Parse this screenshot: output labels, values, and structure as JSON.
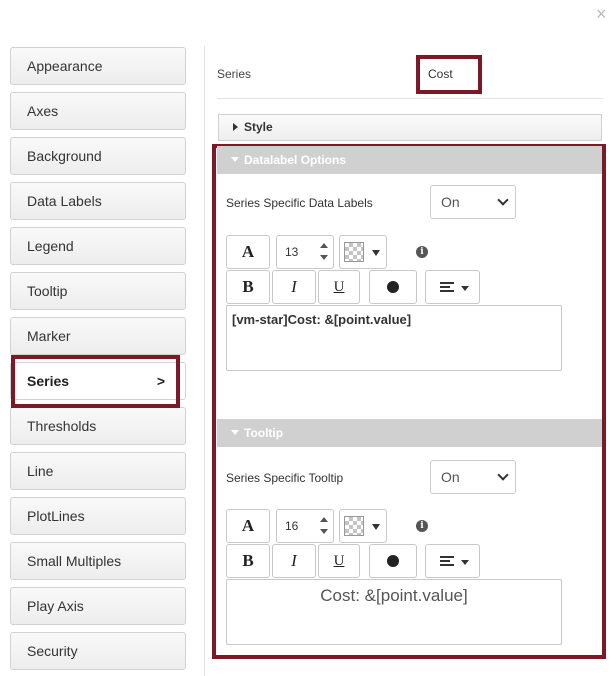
{
  "close_label": "×",
  "sidebar": {
    "items": [
      {
        "label": "Appearance"
      },
      {
        "label": "Axes"
      },
      {
        "label": "Background"
      },
      {
        "label": "Data Labels"
      },
      {
        "label": "Legend"
      },
      {
        "label": "Tooltip"
      },
      {
        "label": "Marker"
      },
      {
        "label": "Series",
        "active": true,
        "chevron": ">"
      },
      {
        "label": "Thresholds"
      },
      {
        "label": "Line"
      },
      {
        "label": "PlotLines"
      },
      {
        "label": "Small Multiples"
      },
      {
        "label": "Play Axis"
      },
      {
        "label": "Security"
      }
    ]
  },
  "main": {
    "series_label": "Series",
    "series_value": "Cost",
    "style_section": {
      "title": "Style"
    },
    "datalabel_section": {
      "title": "Datalabel Options",
      "field_label": "Series Specific Data Labels",
      "toggle_value": "On",
      "font_glyph": "A",
      "font_size": "13",
      "bold": "B",
      "italic": "I",
      "underline": "U",
      "text": "[vm-star]Cost: &[point.value]"
    },
    "tooltip_section": {
      "title": "Tooltip",
      "field_label": "Series Specific Tooltip",
      "toggle_value": "On",
      "font_glyph": "A",
      "font_size": "16",
      "bold": "B",
      "italic": "I",
      "underline": "U",
      "text": "Cost: &[point.value]"
    },
    "info_glyph": "i"
  },
  "colors": {
    "highlight": "#7b1a26",
    "section_header": "#d0d0d0"
  }
}
